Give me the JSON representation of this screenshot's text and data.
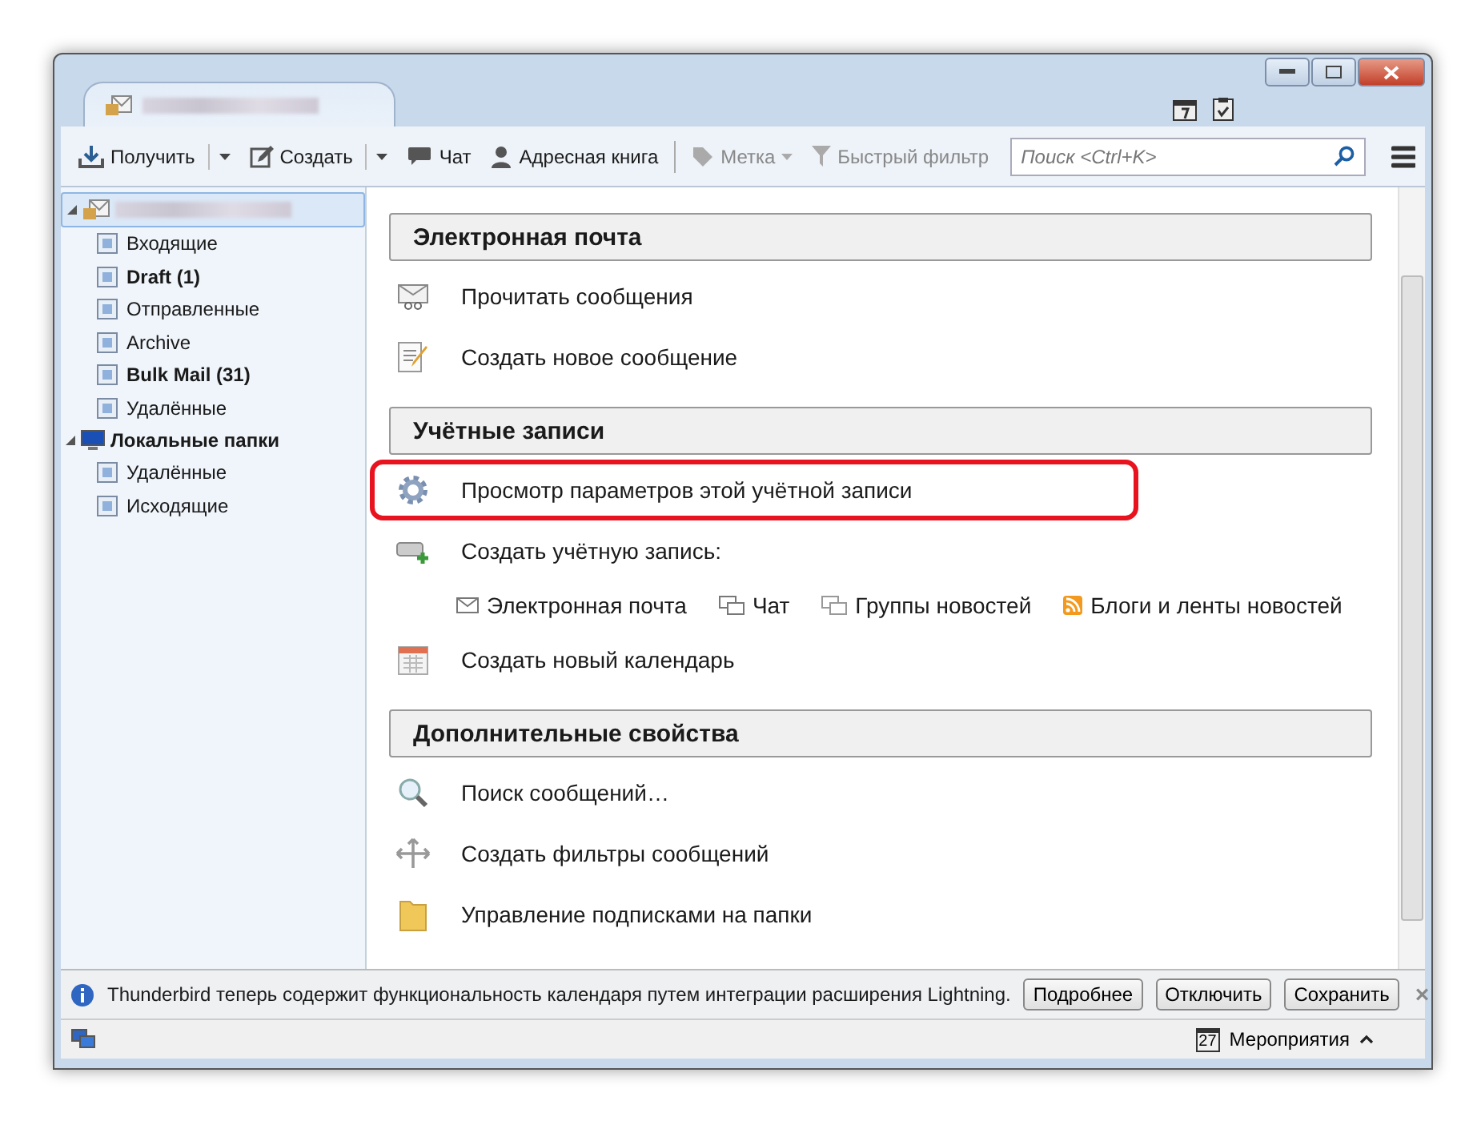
{
  "toolbar": {
    "buttons": [
      {
        "label": "Получить",
        "kind": "split",
        "disabled": false
      },
      {
        "label": "Создать",
        "kind": "split",
        "disabled": false
      },
      {
        "label": "Чат",
        "kind": "plain",
        "disabled": false
      },
      {
        "label": "Адресная книга",
        "kind": "plain",
        "disabled": false
      },
      {
        "label": "Метка",
        "kind": "menu",
        "disabled": true
      },
      {
        "label": "Быстрый фильтр",
        "kind": "plain",
        "disabled": true
      }
    ],
    "search": {
      "placeholder": "Поиск <Ctrl+K>"
    }
  },
  "folders": [
    {
      "expanded": true,
      "selected": true,
      "children": [
        {
          "label": "Входящие",
          "unread": false
        },
        {
          "label": "Draft (1)",
          "unread": true
        },
        {
          "label": "Отправленные",
          "unread": false
        },
        {
          "label": "Archive",
          "unread": false
        },
        {
          "label": "Bulk Mail (31)",
          "unread": true
        },
        {
          "label": "Удалённые",
          "unread": false
        }
      ]
    },
    {
      "label": "Локальные папки",
      "expanded": true,
      "selected": false,
      "children": [
        {
          "label": "Удалённые",
          "unread": false
        },
        {
          "label": "Исходящие",
          "unread": false
        }
      ]
    }
  ],
  "sections": [
    {
      "title": "Электронная почта",
      "items": [
        {
          "kind": "action",
          "label": "Прочитать сообщения",
          "highlighted": false
        },
        {
          "kind": "action",
          "label": "Создать новое сообщение",
          "highlighted": false
        }
      ]
    },
    {
      "title": "Учётные записи",
      "items": [
        {
          "kind": "action",
          "label": "Просмотр параметров этой учётной записи",
          "highlighted": true
        },
        {
          "kind": "links",
          "label": "Создать учётную запись:",
          "highlighted": false,
          "links": [
            "Электронная почта",
            "Чат",
            "Группы новостей",
            "Блоги и ленты новостей"
          ]
        },
        {
          "kind": "action",
          "label": "Создать новый календарь",
          "highlighted": false
        }
      ]
    },
    {
      "title": "Дополнительные свойства",
      "items": [
        {
          "kind": "action",
          "label": "Поиск сообщений…",
          "highlighted": false
        },
        {
          "kind": "action",
          "label": "Создать фильтры сообщений",
          "highlighted": false
        },
        {
          "kind": "action",
          "label": "Управление подписками на папки",
          "highlighted": false
        }
      ]
    }
  ],
  "notification": {
    "text": "Thunderbird теперь содержит функциональность календаря путем интеграции расширения Lightning.",
    "buttons": [
      "Подробнее",
      "Отключить",
      "Сохранить"
    ],
    "close": "×"
  },
  "status_bar": {
    "events": {
      "label": "Мероприятия",
      "day": "27"
    }
  }
}
